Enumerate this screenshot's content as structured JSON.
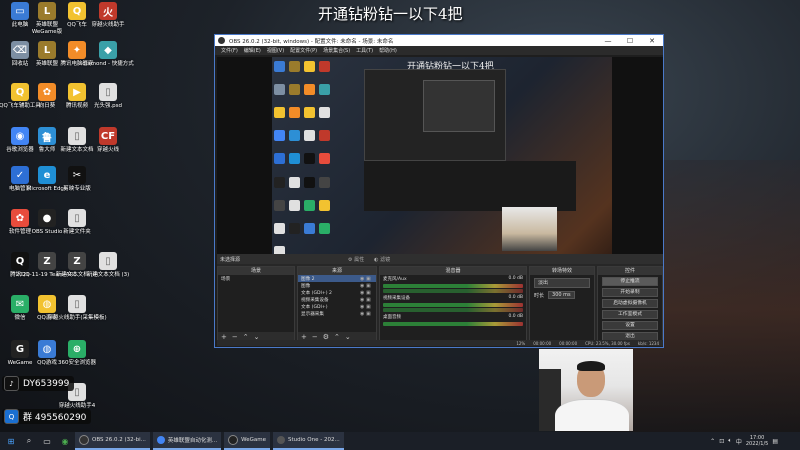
{
  "overlay_title": "开通钻粉钻一以下4把",
  "desktop_icons": [
    {
      "label": "此电脑",
      "color": "#3a7bd5",
      "glyph": "▭",
      "icon": "computer-icon"
    },
    {
      "label": "英雄联盟\nWeGame版",
      "color": "#9a7b2c",
      "glyph": "L",
      "icon": "lol-icon"
    },
    {
      "label": "QQ飞车",
      "color": "#f2c230",
      "glyph": "Q",
      "icon": "qq-icon"
    },
    {
      "label": "穿越火线助手",
      "color": "#c0392b",
      "glyph": "火",
      "icon": "cf-icon"
    },
    {
      "label": "回收站",
      "color": "#7d8fa3",
      "glyph": "⌫",
      "icon": "recycle-bin-icon"
    },
    {
      "label": "英雄联盟",
      "color": "#9a7b2c",
      "glyph": "L",
      "icon": "lol-icon"
    },
    {
      "label": "腾讯电脑管家",
      "color": "#f28c28",
      "glyph": "✦",
      "icon": "tencent-app-icon"
    },
    {
      "label": "diamond - 快捷方式",
      "color": "#3aa0a8",
      "glyph": "◆",
      "icon": "diamond-icon"
    },
    {
      "label": "QQ飞车辅助工具",
      "color": "#f2c230",
      "glyph": "Q",
      "icon": "qq-icon"
    },
    {
      "label": "向日葵",
      "color": "#f28c28",
      "glyph": "✿",
      "icon": "sunflower-icon"
    },
    {
      "label": "腾讯视频",
      "color": "#f2c230",
      "glyph": "▶",
      "icon": "video-icon"
    },
    {
      "label": "光头强.psd",
      "color": "#e0e0e0",
      "glyph": "▯",
      "icon": "file-icon"
    },
    {
      "label": "谷歌浏览器",
      "color": "#4285f4",
      "glyph": "◉",
      "icon": "chrome-icon"
    },
    {
      "label": "鲁大师",
      "color": "#2d8fd5",
      "glyph": "鲁",
      "icon": "ludashi-icon"
    },
    {
      "label": "新建文本文档",
      "color": "#e0e0e0",
      "glyph": "▯",
      "icon": "file-icon"
    },
    {
      "label": "穿越火线",
      "color": "#c0392b",
      "glyph": "CF",
      "icon": "cf-icon"
    },
    {
      "label": "电脑管家",
      "color": "#2d6fd5",
      "glyph": "✓",
      "icon": "shield-icon"
    },
    {
      "label": "Microsoft Edge",
      "color": "#1f8fd5",
      "glyph": "e",
      "icon": "edge-icon"
    },
    {
      "label": "剪映专业版",
      "color": "#111111",
      "glyph": "✂",
      "icon": "capcut-icon"
    },
    {
      "label": "",
      "color": "",
      "glyph": "",
      "icon": ""
    },
    {
      "label": "软件管理",
      "color": "#e74c3c",
      "glyph": "✿",
      "icon": "software-manager-icon"
    },
    {
      "label": "OBS Studio",
      "color": "#222222",
      "glyph": "●",
      "icon": "obs-icon"
    },
    {
      "label": "新建文件夹",
      "color": "#e0e0e0",
      "glyph": "▯",
      "icon": "file-icon"
    },
    {
      "label": "",
      "color": "",
      "glyph": "",
      "icon": ""
    },
    {
      "label": "腾讯QQ",
      "color": "#111111",
      "glyph": "Q",
      "icon": "qq-icon"
    },
    {
      "label": "2021-11-19 Team AR...",
      "color": "#444444",
      "glyph": "Z",
      "icon": "file-icon"
    },
    {
      "label": "新建文本文档 (4)",
      "color": "#444444",
      "glyph": "Z",
      "icon": "file-icon"
    },
    {
      "label": "新建文本文档 (3)",
      "color": "#e0e0e0",
      "glyph": "▯",
      "icon": "file-icon"
    },
    {
      "label": "微信",
      "color": "#2aae67",
      "glyph": "✉",
      "icon": "wechat-icon"
    },
    {
      "label": "QQ游戏",
      "color": "#f2c230",
      "glyph": "◍",
      "icon": "qq-game-icon"
    },
    {
      "label": "穿越火线助手(采集模板)",
      "color": "#e0e0e0",
      "glyph": "▯",
      "icon": "file-icon"
    },
    {
      "label": "",
      "color": "",
      "glyph": "",
      "icon": ""
    },
    {
      "label": "WeGame",
      "color": "#222222",
      "glyph": "G",
      "icon": "wegame-icon"
    },
    {
      "label": "QQ游戏",
      "color": "#3a7bd5",
      "glyph": "◍",
      "icon": "qq-game-icon"
    },
    {
      "label": "360安全浏览器",
      "color": "#2aae67",
      "glyph": "⊕",
      "icon": "browser-icon"
    },
    {
      "label": "",
      "color": "",
      "glyph": "",
      "icon": ""
    },
    {
      "label": "",
      "color": "",
      "glyph": "",
      "icon": ""
    },
    {
      "label": "",
      "color": "",
      "glyph": "",
      "icon": ""
    },
    {
      "label": "穿越火线助手4",
      "color": "#e0e0e0",
      "glyph": "▯",
      "icon": "file-icon"
    },
    {
      "label": "",
      "color": "",
      "glyph": "",
      "icon": ""
    }
  ],
  "badges": {
    "douyin": "DY653999",
    "qq": "群 495560290"
  },
  "obs": {
    "title": "OBS 26.0.2 (32-bit, windows) - 配置文件: 未命名 - 场景: 未命名",
    "menu": [
      "文件(F)",
      "编辑(E)",
      "视图(V)",
      "配置文件(P)",
      "场景集合(S)",
      "工具(T)",
      "帮助(H)"
    ],
    "window_buttons": [
      "—",
      "☐",
      "✕"
    ],
    "canvas_title": "开通钻粉钻一以下4把",
    "scene_bar": {
      "label": "未选择源",
      "properties": "属性",
      "filters": "滤镜"
    },
    "panels": {
      "scenes": {
        "title": "场景",
        "items": [
          "场景"
        ]
      },
      "sources": {
        "title": "来源",
        "items": [
          "图像 2",
          "图像",
          "文本 (GDI+) 2",
          "视频采集设备",
          "文本 (GDI+)",
          "显示器采集"
        ]
      },
      "mixer": {
        "title": "混音器",
        "channels": [
          {
            "name": "麦克风/Aux",
            "db": "0.0 dB"
          },
          {
            "name": "视频采集设备",
            "db": "0.0 dB"
          },
          {
            "name": "桌面音频",
            "db": "0.0 dB"
          }
        ]
      },
      "transitions": {
        "title": "转场特效",
        "selected": "淡出",
        "duration_label": "时长",
        "duration": "300 ms"
      },
      "controls": {
        "title": "控件",
        "buttons": [
          "停止推流",
          "开始录制",
          "启动虚拟摄像机",
          "工作室模式",
          "设置",
          "退出"
        ]
      }
    },
    "status": {
      "fps": "12%",
      "time1": "00:00:00",
      "time2": "00:00:00",
      "cpu": "CPU: 23.5%, 30.00 fps",
      "kbps": "kb/s: 1234"
    }
  },
  "taskbar": {
    "apps": [
      {
        "label": "OBS 26.0.2 (32-bi...",
        "color": "#333333"
      },
      {
        "label": "英雄联盟自动化测...",
        "color": "#4285f4"
      },
      {
        "label": "WeGame",
        "color": "#222222"
      },
      {
        "label": "Studio One - 202...",
        "color": "#555555"
      }
    ],
    "time": "17:00",
    "date": "2022/1/5"
  }
}
